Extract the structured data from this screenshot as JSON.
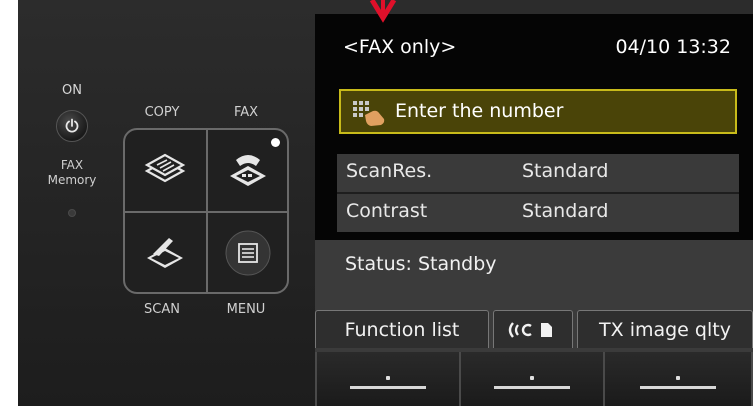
{
  "left_panel": {
    "on_label": "ON",
    "fax_memory_label_line1": "FAX",
    "fax_memory_label_line2": "Memory",
    "copy_label": "COPY",
    "fax_label": "FAX",
    "scan_label": "SCAN",
    "menu_label": "MENU"
  },
  "screen": {
    "mode_title": "<FAX only>",
    "datetime": "04/10 13:32",
    "enter_prompt": "Enter the number",
    "settings": [
      {
        "key": "ScanRes.",
        "value": "Standard"
      },
      {
        "key": "Contrast",
        "value": "Standard"
      }
    ],
    "status": "Status: Standby",
    "function_buttons": {
      "function_list": "Function list",
      "tx_image_quality": "TX image qlty"
    }
  },
  "colors": {
    "highlight_border": "#c8bb1a",
    "highlight_fill": "#4a4408",
    "indicator_arrow": "#e0102a"
  }
}
